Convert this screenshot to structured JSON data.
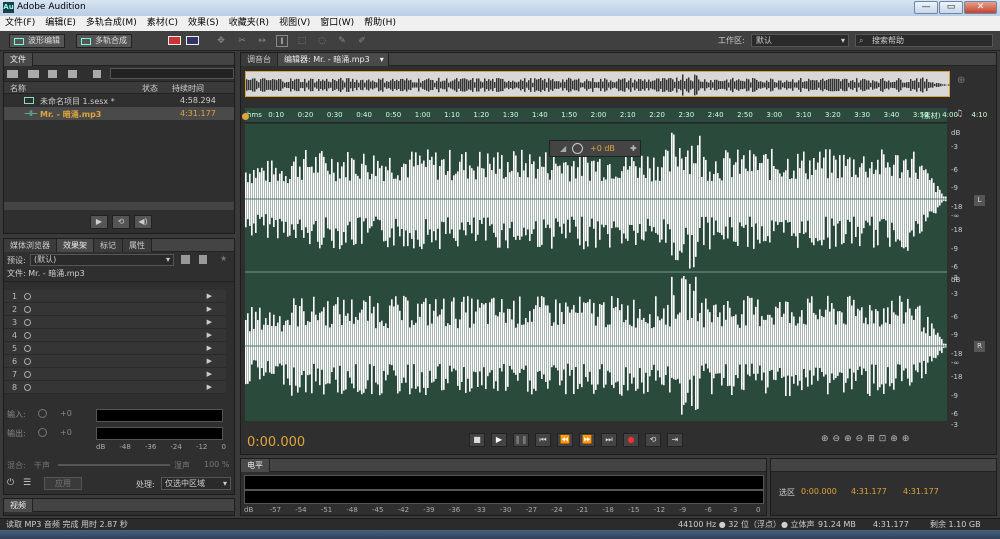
{
  "title_bar": {
    "app_title": "Adobe Audition",
    "logo_text": "Au",
    "min": "—",
    "max": "▭",
    "close": "✕"
  },
  "menu": [
    "文件(F)",
    "编辑(E)",
    "多轨合成(M)",
    "素材(C)",
    "效果(S)",
    "收藏夹(R)",
    "视图(V)",
    "窗口(W)",
    "帮助(H)"
  ],
  "toolbar": {
    "waveform_label": "波形编辑",
    "multitrack_label": "多轨合成",
    "workspace_label": "工作区:",
    "workspace_value": "默认",
    "search_placeholder": "搜索帮助"
  },
  "files_panel": {
    "tab": "文件",
    "columns": {
      "name": "名称",
      "status": "状态",
      "duration": "持续时间"
    },
    "files": [
      {
        "name": "未命名项目 1.sesx *",
        "duration": "4:58.294",
        "type": "session"
      },
      {
        "name": "Mr. - 暗涌.mp3",
        "duration": "4:31.177",
        "type": "audio"
      }
    ]
  },
  "effects_panel": {
    "tabs": [
      "媒体浏览器",
      "效果架",
      "标记",
      "属性"
    ],
    "preset_label": "预设:",
    "preset_value": "(默认)",
    "file_label": "文件: Mr. - 暗涌.mp3",
    "slots": [
      "1",
      "2",
      "3",
      "4",
      "5",
      "6",
      "7",
      "8"
    ],
    "input_label": "输入:",
    "output_label": "输出:",
    "input_val": "+0",
    "output_val": "+0",
    "meter_scale": [
      "dB",
      "-48",
      "-36",
      "-24",
      "-12",
      "0"
    ],
    "mix_label": "混合:",
    "dry_label": "干声",
    "wet_label": "湿声",
    "wet_pct": "100 %",
    "apply_label": "应用",
    "process_label": "处理:",
    "process_value": "仅选中区域"
  },
  "video_panel": {
    "tab": "视频"
  },
  "editor": {
    "tabs": [
      "调音台",
      "编辑器: Mr. - 暗涌.mp3"
    ],
    "ruler": [
      "hms",
      "0:10",
      "0:20",
      "0:30",
      "0:40",
      "0:50",
      "1:00",
      "1:10",
      "1:20",
      "1:30",
      "1:40",
      "1:50",
      "2:00",
      "2:10",
      "2:20",
      "2:30",
      "2:40",
      "2:50",
      "3:00",
      "3:10",
      "3:20",
      "3:30",
      "3:40",
      "3:50",
      "4:00",
      "4:10",
      "(素材)"
    ],
    "hud_gain": "+0 dB",
    "db_scale": [
      "dB",
      "-3",
      "-6",
      "-9",
      "-18",
      "-∞",
      "-18",
      "-9",
      "-6",
      "-3"
    ],
    "channel_left": "L",
    "channel_right": "R",
    "time_display": "0:00.000"
  },
  "levels_panel": {
    "tab": "电平",
    "scale": [
      "dB",
      "-57",
      "-54",
      "-51",
      "-48",
      "-45",
      "-42",
      "-39",
      "-36",
      "-33",
      "-30",
      "-27",
      "-24",
      "-21",
      "-18",
      "-15",
      "-12",
      "-9",
      "-6",
      "-3",
      "0"
    ]
  },
  "selection_panel": {
    "row_label": "选区",
    "start": "0:00.000",
    "end": "4:31.177",
    "duration": "4:31.177"
  },
  "status_bar": {
    "left": "读取 MP3 音频 完成 用时 2.87 秒",
    "sample": "44100 Hz ● 32 位（浮点）● 立体声",
    "size": "91.24 MB",
    "duration": "4:31.177",
    "free": "剩余 1.10 GB"
  },
  "colors": {
    "waveform_bg": "#2a4a3c",
    "waveform": "#ffffff",
    "accent": "#e0a53a",
    "ruler": "#2e4a3f"
  }
}
